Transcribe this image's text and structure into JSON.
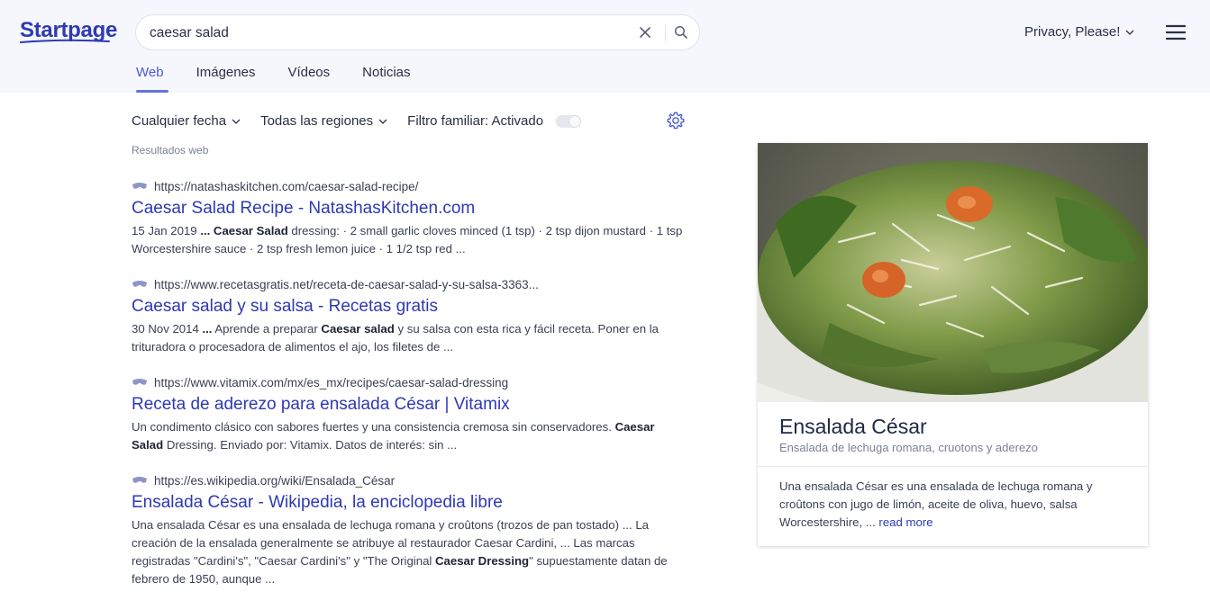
{
  "brand": {
    "logo_text": "Startpage",
    "color": "#2e39b3"
  },
  "search": {
    "query": "caesar salad"
  },
  "header": {
    "privacy_label": "Privacy, Please!"
  },
  "tabs": [
    "Web",
    "Imágenes",
    "Vídeos",
    "Noticias"
  ],
  "active_tab": "Web",
  "filters": {
    "date": "Cualquier fecha",
    "region": "Todas las regiones",
    "family_filter": "Filtro familiar: Activado"
  },
  "results_label": "Resultados web",
  "results": [
    {
      "url": "https://natashaskitchen.com/caesar-salad-recipe/",
      "title": "Caesar Salad Recipe - NatashasKitchen.com",
      "snippet": [
        {
          "t": "15 Jan 2019 "
        },
        {
          "t": "... Caesar Salad",
          "b": true
        },
        {
          "t": " dressing: · 2 small garlic cloves minced (1 tsp) · 2 tsp dijon mustard · 1 tsp Worcestershire sauce · 2 tsp fresh lemon juice · 1 1/2 tsp red ..."
        }
      ]
    },
    {
      "url": "https://www.recetasgratis.net/receta-de-caesar-salad-y-su-salsa-3363...",
      "title": "Caesar salad y su salsa - Recetas gratis",
      "snippet": [
        {
          "t": "30 Nov 2014 "
        },
        {
          "t": "...",
          "b": true
        },
        {
          "t": " Aprende a preparar "
        },
        {
          "t": "Caesar salad",
          "b": true
        },
        {
          "t": " y su salsa con esta rica y fácil receta. Poner en la trituradora o procesadora de alimentos el ajo, los filetes de ..."
        }
      ]
    },
    {
      "url": "https://www.vitamix.com/mx/es_mx/recipes/caesar-salad-dressing",
      "title": "Receta de aderezo para ensalada César | Vitamix",
      "snippet": [
        {
          "t": "Un condimento clásico con sabores fuertes y una consistencia cremosa sin conservadores. "
        },
        {
          "t": "Caesar Salad",
          "b": true
        },
        {
          "t": " Dressing. Enviado por: Vitamix. Datos de interés: sin ..."
        }
      ]
    },
    {
      "url": "https://es.wikipedia.org/wiki/Ensalada_César",
      "title": "Ensalada César - Wikipedia, la enciclopedia libre",
      "snippet": [
        {
          "t": "Una ensalada César es una ensalada de lechuga romana y croûtons (trozos de pan tostado) ... La creación de la ensalada generalmente se atribuye al restaurador Caesar Cardini, ... Las marcas registradas \"Cardini's\", \"Caesar Cardini's\" y \"The Original "
        },
        {
          "t": "Caesar Dressing",
          "b": true
        },
        {
          "t": "\" supuestamente datan de febrero de 1950, aunque ..."
        }
      ]
    }
  ],
  "knowledge_panel": {
    "title": "Ensalada César",
    "subtitle": "Ensalada de lechuga romana, cruotons y aderezo",
    "description": "Una ensalada César es una ensalada de lechuga romana y croûtons con jugo de limón, aceite de oliva, huevo, salsa Worcestershire, ... ",
    "read_more": "read more"
  }
}
